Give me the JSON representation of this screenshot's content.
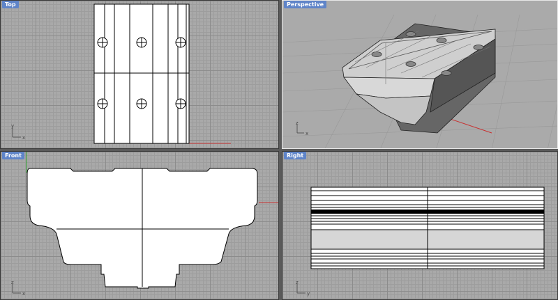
{
  "viewports": {
    "top": {
      "title": "Top"
    },
    "perspective": {
      "title": "Perspective"
    },
    "front": {
      "title": "Front"
    },
    "right": {
      "title": "Right"
    }
  },
  "axis_labels": {
    "x": "x",
    "y": "y",
    "z": "z"
  },
  "colors": {
    "viewport_bg": "#a9a9a9",
    "grid_minor": "#9d9d9d",
    "grid_major": "#8c8c8c",
    "x_axis": "#c83030",
    "y_axis": "#30a030",
    "title_bar": "#5f84c8",
    "active_border": "#e8e8e8"
  }
}
